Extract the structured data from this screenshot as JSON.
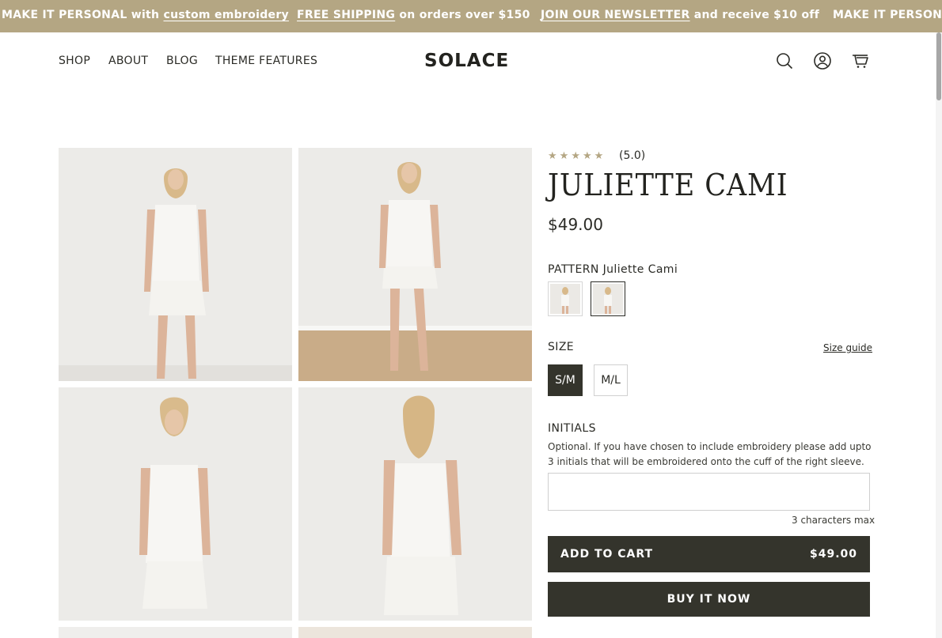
{
  "announcement": {
    "items": [
      {
        "text": "MAKE IT PERSONAL with",
        "link": "custom embroidery"
      },
      {
        "link": "FREE SHIPPING",
        "text": "on orders over $150"
      },
      {
        "link": "JOIN OUR NEWSLETTER",
        "text": "and receive $10 off"
      },
      {
        "text": "MAKE IT PERSONAL with"
      }
    ],
    "bg_color": "#b4a683"
  },
  "header": {
    "nav": [
      "SHOP",
      "ABOUT",
      "BLOG",
      "THEME FEATURES"
    ],
    "logo": "SOLACE",
    "icons": [
      "search-icon",
      "account-icon",
      "cart-icon"
    ]
  },
  "product": {
    "rating_stars": 5,
    "rating_text": "(5.0)",
    "title": "JULIETTE CAMI",
    "price": "$49.00",
    "pattern_label": "PATTERN",
    "pattern_value": "Juliette Cami",
    "size_label": "SIZE",
    "size_guide": "Size guide",
    "sizes": [
      "S/M",
      "M/L"
    ],
    "selected_size": "S/M",
    "initials_label": "INITIALS",
    "initials_help": "Optional. If you have chosen to include embroidery please add upto 3 initials that will be embroidered onto the cuff of the right sleeve.",
    "initials_value": "",
    "initials_max": "3 characters max",
    "add_to_cart": "ADD TO CART",
    "add_to_cart_price": "$49.00",
    "buy_now": "BUY IT NOW",
    "accent_color": "#34342c"
  }
}
